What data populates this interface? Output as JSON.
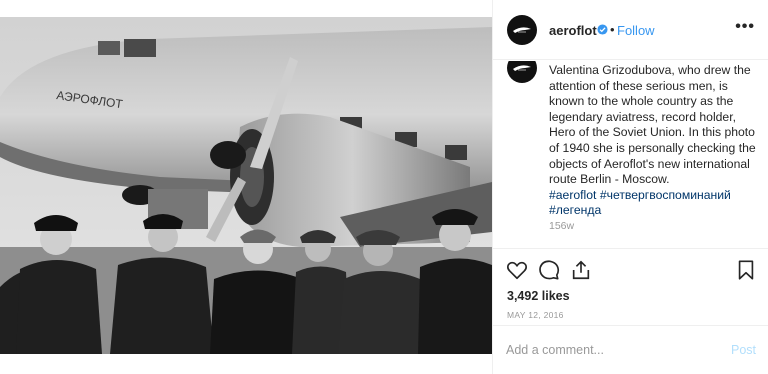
{
  "post": {
    "photo": {
      "fuselage_text": "АЭРОФЛОТ",
      "alt_icon": "photo-bw-airplane-crew"
    },
    "header": {
      "username": "aeroflot",
      "separator": "•",
      "follow_label": "Follow",
      "more_label": "•••",
      "avatar_icon": "aeroflot-logo-icon",
      "verified_icon": "verified-badge-icon"
    },
    "caption": {
      "text": "Valentina Grizodubova, who drew the attention of these serious men, is known to the whole country as the legendary aviatress, record holder, Hero of the Soviet Union. In this photo of 1940 she is personally checking the objects of Aeroflot's new international route Berlin - Moscow.",
      "hashtags_line1": "#aeroflot #четвергвоспоминаний",
      "hashtags_line2": "#легенда",
      "time_ago": "156w"
    },
    "actions": {
      "like_icon": "heart-icon",
      "comment_icon": "comment-icon",
      "share_icon": "share-icon",
      "save_icon": "bookmark-icon"
    },
    "likes": "3,492 likes",
    "date": "MAY 12, 2016",
    "comment_box": {
      "placeholder": "Add a comment...",
      "post_label": "Post"
    },
    "colors": {
      "link": "#3897f0",
      "hashtag": "#003569",
      "post_disabled": "#b2dffc",
      "border": "#efefef"
    }
  }
}
